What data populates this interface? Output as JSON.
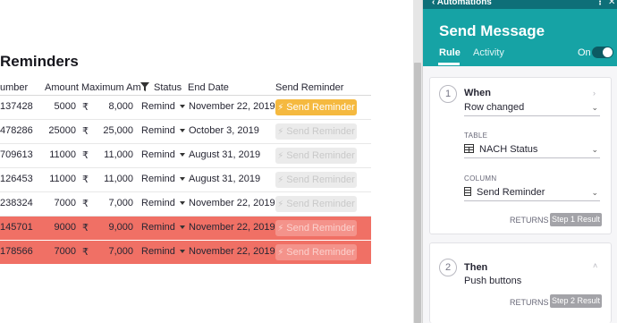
{
  "page_title": "Reminders",
  "table": {
    "headers": {
      "number": "umber",
      "amount": "Amount",
      "max_amount": "Maximum Am",
      "status": "Status",
      "end_date": "End Date",
      "send_reminder": "Send Reminder"
    },
    "currency_symbol": "₹",
    "rows": [
      {
        "number": "137428",
        "amount": "5000",
        "max_amount": "8,000",
        "status": "Remind",
        "end_date": "November 22, 2019",
        "button": "Send Reminder",
        "button_active": true,
        "highlight": false
      },
      {
        "number": "478286",
        "amount": "25000",
        "max_amount": "25,000",
        "status": "Remind",
        "end_date": "October 3, 2019",
        "button": "Send Reminder",
        "button_active": false,
        "highlight": false
      },
      {
        "number": "709613",
        "amount": "11000",
        "max_amount": "11,000",
        "status": "Remind",
        "end_date": "August 31, 2019",
        "button": "Send Reminder",
        "button_active": false,
        "highlight": false
      },
      {
        "number": "126453",
        "amount": "11000",
        "max_amount": "11,000",
        "status": "Remind",
        "end_date": "August 31, 2019",
        "button": "Send Reminder",
        "button_active": false,
        "highlight": false
      },
      {
        "number": "238324",
        "amount": "7000",
        "max_amount": "7,000",
        "status": "Remind",
        "end_date": "November 22, 2019",
        "button": "Send Reminder",
        "button_active": false,
        "highlight": false
      },
      {
        "number": "145701",
        "amount": "9000",
        "max_amount": "9,000",
        "status": "Remind",
        "end_date": "November 22, 2019",
        "button": "Send Reminder",
        "button_active": false,
        "highlight": true
      },
      {
        "number": "178566",
        "amount": "7000",
        "max_amount": "7,000",
        "status": "Remind",
        "end_date": "November 22, 2019",
        "button": "Send Reminder",
        "button_active": false,
        "highlight": true
      }
    ]
  },
  "panel": {
    "topbar_label": "Automations",
    "title": "Send Message",
    "tabs": [
      {
        "label": "Rule",
        "active": true
      },
      {
        "label": "Activity",
        "active": false
      }
    ],
    "toggle_label": "On",
    "toggle_on": true,
    "step1": {
      "number": "1",
      "title": "When",
      "trigger": "Row changed",
      "table_label": "TABLE",
      "table_value": "NACH Status",
      "column_label": "COLUMN",
      "column_value": "Send Reminder",
      "returns_label": "RETURNS",
      "result_label": "Step 1 Result"
    },
    "step2": {
      "number": "2",
      "title": "Then",
      "action": "Push buttons",
      "returns_label": "RETURNS",
      "result_label": "Step 2 Result"
    }
  },
  "colors": {
    "accent_teal": "#16a3a5",
    "topbar_teal": "#0e6f78",
    "active_button": "#f5b93f",
    "row_highlight": "#f07065"
  },
  "icons": {
    "filter": "filter-icon",
    "bolt": "lightning-icon",
    "table": "table-icon",
    "column": "column-icon",
    "back": "back-chevron-icon",
    "more": "more-vertical-icon",
    "close": "close-icon"
  }
}
